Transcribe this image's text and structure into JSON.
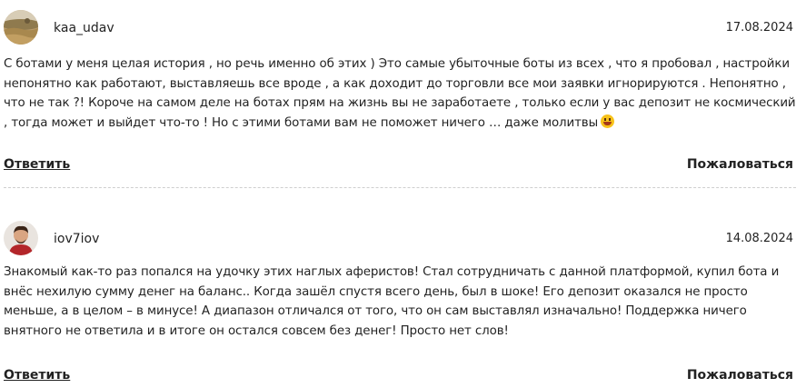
{
  "comments": [
    {
      "username": "kaa_udav",
      "date": "17.08.2024",
      "text": "С ботами у меня целая история , но речь именно об этих ) Это самые убыточные боты из всех , что я пробовал , настройки непонятно как работают, выставляешь все вроде , а как доходит до торговли все мои заявки игнорируются . Непонятно , что не так ?! Короче на самом деле на ботах прям на жизнь вы не заработаете , только если у вас депозит не космический , тогда может и выйдет что-то ! Но с этими ботами вам не поможет ничего … даже молитвы",
      "reply_label": "Ответить",
      "report_label": "Пожаловаться",
      "avatar_icon": "avatar-photo-field",
      "emoji_icon": "grinning-face-emoji"
    },
    {
      "username": "iov7iov",
      "date": "14.08.2024",
      "text": "Знакомый как-то раз попался на удочку этих наглых аферистов! Стал сотрудничать с данной платформой, купил бота и внёс нехилую сумму денег на баланс.. Когда зашёл спустя всего день, был в шоке! Его депозит оказался не просто меньше, а в целом – в минусе! А диапазон отличался от того, что он сам выставлял изначально! Поддержка ничего внятного не ответила и в итоге он остался совсем без денег! Просто нет слов!",
      "reply_label": "Ответить",
      "report_label": "Пожаловаться",
      "avatar_icon": "avatar-photo-person"
    }
  ],
  "colors": {
    "text": "#222222",
    "divider": "#cfcfcf",
    "background": "#ffffff"
  }
}
